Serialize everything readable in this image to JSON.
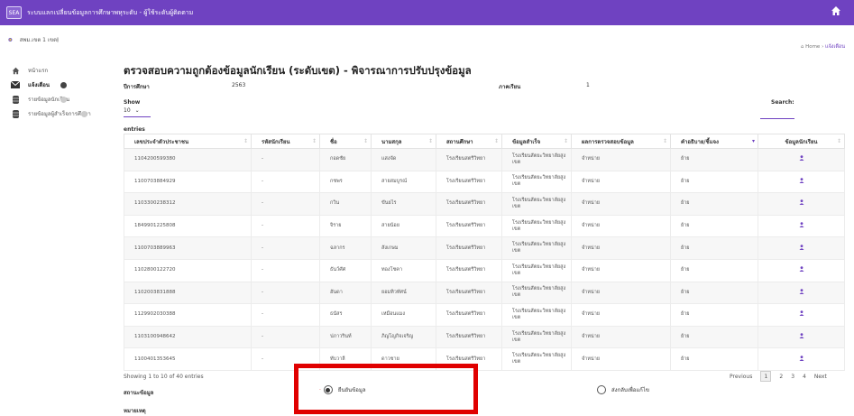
{
  "app": {
    "system_title": "ระบบแลกเปลี่ยนข้อมูลการศึกษาพหุระดับ - ผู้ใช้ระดับผู้ติดตาม",
    "logo_text": "SEA"
  },
  "sidebar": {
    "user_name": "สพม.เขต 1 เขต",
    "items": [
      {
        "label": "หน้าแรก"
      },
      {
        "label": "แจ้งเตือน"
      },
      {
        "label": "รายข้อมูลนักเรียน"
      },
      {
        "label": "รายข้อมูลผู้สำเร็จการศึกษา"
      }
    ]
  },
  "breadcrumb": {
    "home": "Home",
    "separator": " › ",
    "current": "แจ้งเตือน"
  },
  "page": {
    "title": "ตรวจสอบความถูกต้องข้อมูลนักเรียน (ระดับเขต) - พิจารณาการปรับปรุงข้อมูล",
    "year_label": "ปีการศึกษา",
    "year_value": "2563",
    "term_label": "ภาคเรียน",
    "term_value": "1",
    "show_label": "Show",
    "show_value": "10",
    "entries_label": "entries",
    "search_label": "Search:"
  },
  "table": {
    "columns": [
      "เลขประจำตัวประชาชน",
      "รหัสนักเรียน",
      "ชื่อ",
      "นามสกุล",
      "สถานศึกษา",
      "ข้อมูลสำเร็จ",
      "ผลการตรวจสอบข้อมูล",
      "คำอธิบาย/ชี้แจง",
      "ข้อมูลนักเรียน"
    ],
    "rows": [
      [
        "1104200599380",
        "-",
        "กอดชัย",
        "แสงจัด",
        "โรงเรียนสตรีวิทยา",
        "โรงเรียนสัตยะวิทยาลัยสูงเขต",
        "จำหน่าย",
        "ย้าย"
      ],
      [
        "1100703884929",
        "-",
        "กชพร",
        "สายสมบูรณ์",
        "โรงเรียนสตรีวิทยา",
        "โรงเรียนสัตยะวิทยาลัยสูงเขต",
        "จำหน่าย",
        "ย้าย"
      ],
      [
        "1103300238312",
        "-",
        "กวิน",
        "ขันยไร",
        "โรงเรียนสตรีวิทยา",
        "โรงเรียนสัตยะวิทยาลัยสูงเขต",
        "จำหน่าย",
        "ย้าย"
      ],
      [
        "1849901225808",
        "-",
        "จิราย",
        "สายน้อย",
        "โรงเรียนสตรีวิทยา",
        "โรงเรียนสัตยะวิทยาลัยสูงเขต",
        "จำหน่าย",
        "ย้าย"
      ],
      [
        "1100703889963",
        "-",
        "ฉลากร",
        "สังเกษม",
        "โรงเรียนสตรีวิทยา",
        "โรงเรียนสัตยะวิทยาลัยสูงเขต",
        "จำหน่าย",
        "ย้าย"
      ],
      [
        "1102800122720",
        "-",
        "ธันว์ศัศ",
        "ทองโชคา",
        "โรงเรียนสตรีวิทยา",
        "โรงเรียนสัตยะวิทยาลัยสูงเขต",
        "จำหน่าย",
        "ย้าย"
      ],
      [
        "1102003831888",
        "-",
        "ฮันดา",
        "ยอมทิวทัศน์",
        "โรงเรียนสตรีวิทยา",
        "โรงเรียนสัตยะวิทยาลัยสูงเขต",
        "จำหน่าย",
        "ย้าย"
      ],
      [
        "1129902030388",
        "-",
        "ธนัสร",
        "เหมือนแมง",
        "โรงเรียนสตรีวิทยา",
        "โรงเรียนสัตยะวิทยาลัยสูงเขต",
        "จำหน่าย",
        "ย้าย"
      ],
      [
        "1103100948642",
        "-",
        "ปภาวรินท์",
        "ภิญโญกิจเจริญ",
        "โรงเรียนสตรีวิทยา",
        "โรงเรียนสัตยะวิทยาลัยสูงเขต",
        "จำหน่าย",
        "ย้าย"
      ],
      [
        "1100401353645",
        "-",
        "ทับวาลี",
        "ดาวชาย",
        "โรงเรียนสตรีวิทยา",
        "โรงเรียนสัตยะวิทยาลัยสูงเขต",
        "จำหน่าย",
        "ย้าย"
      ]
    ]
  },
  "footer": {
    "showing": "Showing 1 to 10 of 40 entries",
    "previous": "Previous",
    "pages": [
      "1",
      "2",
      "3",
      "4"
    ],
    "next": "Next",
    "status_label": "สถานะข้อมูล",
    "note_label": "หมายเหตุ",
    "radio_confirm": "ยืนยันข้อมูล",
    "radio_return": "ส่งกลับเพื่อแก้ไข"
  },
  "colors": {
    "brand": "#6f42c1",
    "highlight": "#e00000"
  }
}
